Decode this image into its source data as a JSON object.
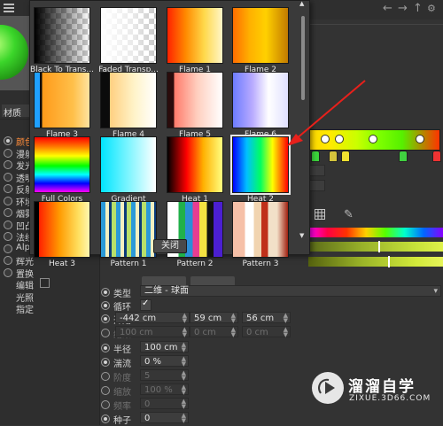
{
  "app": {
    "material_label": "材质",
    "channels": [
      {
        "label": "颜色",
        "radio": true,
        "checked": true,
        "active": true
      },
      {
        "label": "漫射",
        "radio": true,
        "checked": false,
        "active": false
      },
      {
        "label": "发光",
        "radio": true,
        "checked": false,
        "active": false
      },
      {
        "label": "透明",
        "radio": true,
        "checked": false,
        "active": false
      },
      {
        "label": "反射",
        "radio": true,
        "checked": false,
        "active": false
      },
      {
        "label": "环境",
        "radio": true,
        "checked": false,
        "active": false
      },
      {
        "label": "烟雾",
        "radio": true,
        "checked": false,
        "active": false
      },
      {
        "label": "凹凸",
        "radio": true,
        "checked": false,
        "active": false
      },
      {
        "label": "法线",
        "radio": true,
        "checked": false,
        "active": false
      },
      {
        "label": "Alp",
        "radio": true,
        "checked": false,
        "active": false
      },
      {
        "label": "辉光",
        "radio": true,
        "checked": false,
        "active": false
      },
      {
        "label": "置换",
        "radio": true,
        "checked": false,
        "active": false
      },
      {
        "label": "编辑",
        "radio": false,
        "checked": false,
        "active": false
      },
      {
        "label": "光照",
        "radio": false,
        "checked": false,
        "active": false
      },
      {
        "label": "指定",
        "radio": false,
        "checked": false,
        "active": false
      }
    ],
    "nav_icons": [
      "arrow-left-icon",
      "arrow-right-icon",
      "arrow-up-icon",
      "settings-icon"
    ]
  },
  "properties": {
    "type": {
      "label": "类型",
      "value": "二维 - 球面"
    },
    "loop": {
      "label": "循环",
      "checked": true
    },
    "start": {
      "label": "开始",
      "x": "-442 cm",
      "y": "59 cm",
      "z": "56 cm"
    },
    "end": {
      "label": "结束",
      "x": "100 cm",
      "y": "0 cm",
      "z": "0 cm"
    },
    "radius": {
      "label": "半径",
      "value": "100 cm"
    },
    "turbulence": {
      "label": "湍流",
      "value": "0 %"
    },
    "octaves": {
      "label": "阶度",
      "value": "5"
    },
    "scale": {
      "label": "缩放",
      "value": "100 %"
    },
    "frequency": {
      "label": "频率",
      "value": "0"
    },
    "seed": {
      "label": "种子",
      "value": "0"
    }
  },
  "popup": {
    "close_label": "关闭",
    "presets": [
      {
        "label": "Black To Trans..."
      },
      {
        "label": "Faded Transp..."
      },
      {
        "label": "Flame 1"
      },
      {
        "label": "Flame 2"
      },
      {
        "label": "Flame 3"
      },
      {
        "label": "Flame 4"
      },
      {
        "label": "Flame 5"
      },
      {
        "label": "Flame 6"
      },
      {
        "label": "Full Colors"
      },
      {
        "label": "Gradient"
      },
      {
        "label": "Heat 1"
      },
      {
        "label": "Heat 2",
        "selected": true
      },
      {
        "label": "Heat 3"
      },
      {
        "label": "Pattern 1"
      },
      {
        "label": "Pattern 2"
      },
      {
        "label": "Pattern 3"
      }
    ]
  },
  "watermark": {
    "main": "溜溜自学",
    "sub": "ZIXUE.3D66.COM"
  }
}
